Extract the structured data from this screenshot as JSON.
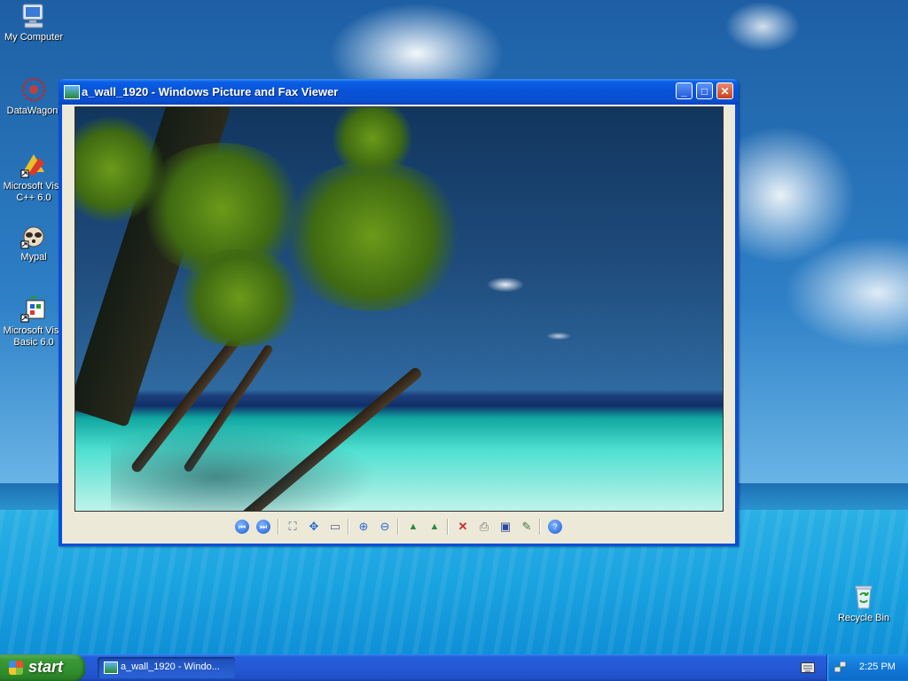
{
  "desktop": {
    "icons": [
      {
        "label": "My Computer",
        "icon": "computer-icon"
      },
      {
        "label": "DataWagon.",
        "icon": "datawagon-icon"
      },
      {
        "label": "Microsoft Visu\nC++ 6.0",
        "icon": "visual-cpp-icon"
      },
      {
        "label": "Mypal",
        "icon": "mypal-browser-icon"
      },
      {
        "label": "Microsoft Visu\nBasic 6.0",
        "icon": "visual-basic-icon"
      },
      {
        "label": "Recycle Bin",
        "icon": "recycle-bin-icon"
      }
    ]
  },
  "window": {
    "title": "a_wall_1920 - Windows Picture and Fax Viewer",
    "controls": {
      "minimize": "_",
      "maximize": "□",
      "close": "✕"
    },
    "toolbar": [
      {
        "name": "previous-image-button",
        "glyph": "⏮",
        "icon": "previous-icon"
      },
      {
        "name": "next-image-button",
        "glyph": "⏭",
        "icon": "next-icon"
      },
      {
        "name": "best-fit-button",
        "glyph": "⛶",
        "icon": "best-fit-icon"
      },
      {
        "name": "actual-size-button",
        "glyph": "✥",
        "icon": "actual-size-icon"
      },
      {
        "name": "slideshow-button",
        "glyph": "▭",
        "icon": "slideshow-icon"
      },
      {
        "name": "zoom-in-button",
        "glyph": "⊕",
        "icon": "zoom-in-icon"
      },
      {
        "name": "zoom-out-button",
        "glyph": "⊖",
        "icon": "zoom-out-icon"
      },
      {
        "name": "rotate-clockwise-button",
        "glyph": "▲",
        "icon": "rotate-clockwise-icon"
      },
      {
        "name": "rotate-counterclockwise-button",
        "glyph": "▲",
        "icon": "rotate-counterclockwise-icon"
      },
      {
        "name": "delete-button",
        "glyph": "✕",
        "icon": "delete-icon"
      },
      {
        "name": "print-button",
        "glyph": "⎙",
        "icon": "print-icon"
      },
      {
        "name": "save-button",
        "glyph": "▣",
        "icon": "save-icon"
      },
      {
        "name": "edit-button",
        "glyph": "✎",
        "icon": "edit-icon"
      },
      {
        "name": "help-button",
        "glyph": "?",
        "icon": "help-icon"
      }
    ]
  },
  "taskbar": {
    "start_label": "start",
    "task_button": "a_wall_1920 - Windo...",
    "clock": "2:25 PM"
  },
  "colors": {
    "title_bar": "#0752d6",
    "taskbar": "#2559d6",
    "start_button": "#3a9a36",
    "close_button": "#c8401d",
    "window_client": "#ece9d8"
  }
}
